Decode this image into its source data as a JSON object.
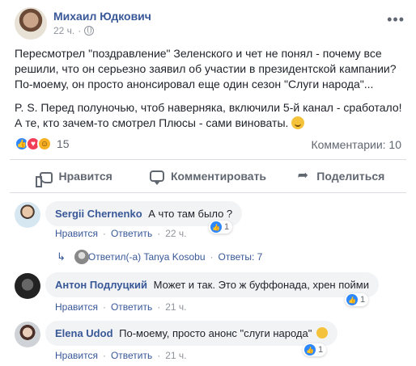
{
  "post": {
    "author": "Михаил Юдкович",
    "time": "22 ч.",
    "more_icon": "more-icon",
    "paragraph1": "Пересмотрел \"поздравление\" Зеленского и чет не понял - почему все решили, что он серьезно заявил об участии в президентской кампании? По-моему, он просто анонсировал еще один сезон \"Слуги народа\"...",
    "paragraph2": "P. S. Перед полуночью, чтоб наверняка, включили 5-й канал - сработало! А те, кто зачем-то смотрел Плюсы - сами виноваты.",
    "reactions_count": "15",
    "comments_label": "Комментарии: 10"
  },
  "actions": {
    "like": "Нравится",
    "comment": "Комментировать",
    "share": "Поделиться"
  },
  "comments": [
    {
      "name": "Sergii Chernenko",
      "text": "А что там было ?",
      "like": "Нравится",
      "reply": "Ответить",
      "time": "22 ч.",
      "likes": "1"
    },
    {
      "name": "Антон Подлуцкий",
      "text": "Может и так. Это ж буффонада, хрен пойми",
      "like": "Нравится",
      "reply": "Ответить",
      "time": "21 ч.",
      "likes": "1"
    },
    {
      "name": "Elena Udod",
      "text": "По-моему, просто анонс \"слуги народа\"",
      "like": "Нравится",
      "reply": "Ответить",
      "time": "21 ч.",
      "likes": "1"
    }
  ],
  "replies": {
    "text": "Ответил(-а) Tanya Kosobu",
    "dot": "·",
    "count": "Ответы: 7"
  },
  "colors": {
    "link": "#385898",
    "meta": "#90949c",
    "like_blue": "#2d88ff",
    "love_red": "#f33e58",
    "haha_yellow": "#f7b125"
  }
}
